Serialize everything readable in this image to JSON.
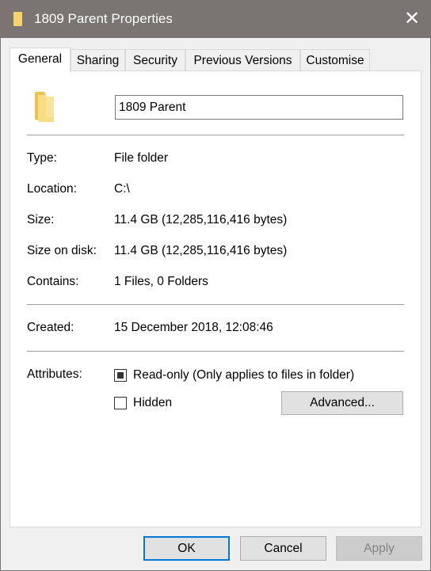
{
  "window": {
    "title": "1809 Parent Properties",
    "close_icon": "close-icon"
  },
  "tabs": [
    {
      "label": "General",
      "active": true
    },
    {
      "label": "Sharing",
      "active": false
    },
    {
      "label": "Security",
      "active": false
    },
    {
      "label": "Previous Versions",
      "active": false
    },
    {
      "label": "Customise",
      "active": false
    }
  ],
  "general": {
    "folder_icon": "folder-icon",
    "name_value": "1809 Parent",
    "details": [
      {
        "label": "Type:",
        "value": "File folder"
      },
      {
        "label": "Location:",
        "value": "C:\\"
      },
      {
        "label": "Size:",
        "value": "11.4 GB (12,285,116,416 bytes)"
      },
      {
        "label": "Size on disk:",
        "value": "11.4 GB (12,285,116,416 bytes)"
      },
      {
        "label": "Contains:",
        "value": "1 Files, 0 Folders"
      }
    ],
    "created": {
      "label": "Created:",
      "value": "15 December 2018, 12:08:46"
    },
    "attributes": {
      "label": "Attributes:",
      "readonly": {
        "label": "Read-only (Only applies to files in folder)",
        "state": "indeterminate"
      },
      "hidden": {
        "label": "Hidden",
        "checked": false
      },
      "advanced_label": "Advanced..."
    }
  },
  "footer": {
    "ok_label": "OK",
    "cancel_label": "Cancel",
    "apply_label": "Apply",
    "apply_enabled": false
  }
}
